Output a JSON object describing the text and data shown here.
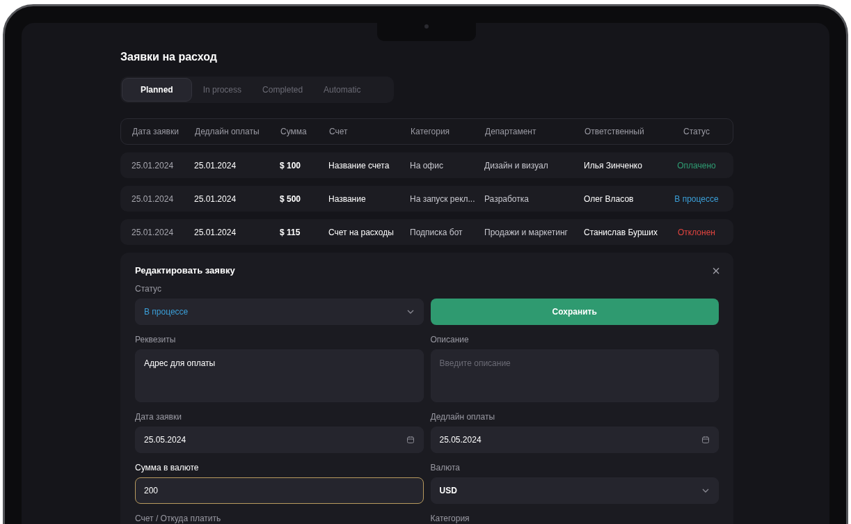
{
  "title": "Заявки на расход",
  "tabs": [
    {
      "label": "Planned",
      "selected": true
    },
    {
      "label": "In process",
      "selected": false
    },
    {
      "label": "Completed",
      "selected": false
    },
    {
      "label": "Automatic",
      "selected": false
    }
  ],
  "table": {
    "columns": [
      "Дата заявки",
      "Дедлайн оплаты",
      "Сумма",
      "Счет",
      "Категория",
      "Департамент",
      "Ответственный",
      "Статус"
    ],
    "rows": [
      {
        "cells": [
          "25.01.2024",
          "25.01.2024",
          "$ 100",
          "Название счета",
          "На офис",
          "Дизайн и визуал",
          "Илья Зинченко",
          "Оплачено"
        ],
        "color": "#2f9e74"
      },
      {
        "cells": [
          "25.01.2024",
          "25.01.2024",
          "$ 500",
          "Название",
          "На запуск рекл...",
          "Разработка",
          "Олег Власов",
          "В процессе"
        ],
        "color": "#3b9fd8"
      },
      {
        "cells": [
          "25.01.2024",
          "25.01.2024",
          "$ 115",
          "Счет на расходы",
          "Подписка бот",
          "Продажи и маркетинг",
          "Станислав Бурших",
          "Отклонен"
        ],
        "color": "#e0443f"
      }
    ]
  },
  "edit_panel": {
    "title": "Редактировать заявку",
    "close": "×",
    "fields": [
      {
        "kind": "select",
        "label": "Статус",
        "value": "В процессе",
        "color": "#3b9fd8",
        "focused": false
      },
      {
        "kind": "button",
        "text": "Сохранить"
      },
      {
        "kind": "textarea",
        "label": "Реквезиты",
        "value": "Адрес для оплаты",
        "focused": false
      },
      {
        "kind": "textarea",
        "label": "Описание",
        "placeholder": "Введите описание",
        "focused": false
      },
      {
        "kind": "date",
        "label": "Дата заявки",
        "value": "25.05.2024",
        "focused": false
      },
      {
        "kind": "date",
        "label": "Дедлайн оплаты",
        "value": "25.05.2024",
        "focused": false
      },
      {
        "kind": "input",
        "label": "Сумма в валюте",
        "value": "200",
        "focused": true
      },
      {
        "kind": "select",
        "label": "Валюта",
        "value": "USD",
        "focused": false
      },
      {
        "kind": "label",
        "label": "Счет / Откуда платить"
      },
      {
        "kind": "label",
        "label": "Категория"
      }
    ]
  }
}
